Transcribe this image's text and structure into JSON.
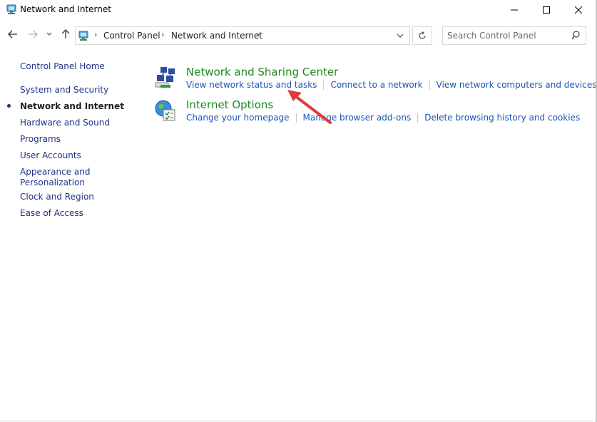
{
  "window": {
    "title": "Network and Internet",
    "controls": [
      "minimize-icon",
      "maximize-icon",
      "close-icon"
    ]
  },
  "navigation": {
    "back_icon": "arrow-left-icon",
    "forward_icon": "arrow-right-icon",
    "recent_icon": "chevron-down-icon",
    "up_icon": "arrow-up-icon"
  },
  "address": {
    "breadcrumbs": [
      "Control Panel",
      "Network and Internet"
    ],
    "refresh_icon": "refresh-icon"
  },
  "search": {
    "placeholder": "Search Control Panel",
    "value": ""
  },
  "sidebar": {
    "items": [
      {
        "label": "Control Panel Home",
        "active": false
      },
      {
        "label": "System and Security",
        "active": false
      },
      {
        "label": "Network and Internet",
        "active": true
      },
      {
        "label": "Hardware and Sound",
        "active": false
      },
      {
        "label": "Programs",
        "active": false
      },
      {
        "label": "User Accounts",
        "active": false
      },
      {
        "label": "Appearance and Personalization",
        "active": false
      },
      {
        "label": "Clock and Region",
        "active": false
      },
      {
        "label": "Ease of Access",
        "active": false
      }
    ]
  },
  "categories": [
    {
      "title": "Network and Sharing Center",
      "icon": "network-sharing-center-icon",
      "links": [
        "View network status and tasks",
        "Connect to a network",
        "View network computers and devices"
      ]
    },
    {
      "title": "Internet Options",
      "icon": "internet-options-icon",
      "links": [
        "Change your homepage",
        "Manage browser add-ons",
        "Delete browsing history and cookies"
      ]
    }
  ],
  "colors": {
    "category_title": "#1c8a1c",
    "link": "#1a55b3",
    "nav_link": "#1e3287",
    "annotation_arrow": "#e23b3b"
  }
}
